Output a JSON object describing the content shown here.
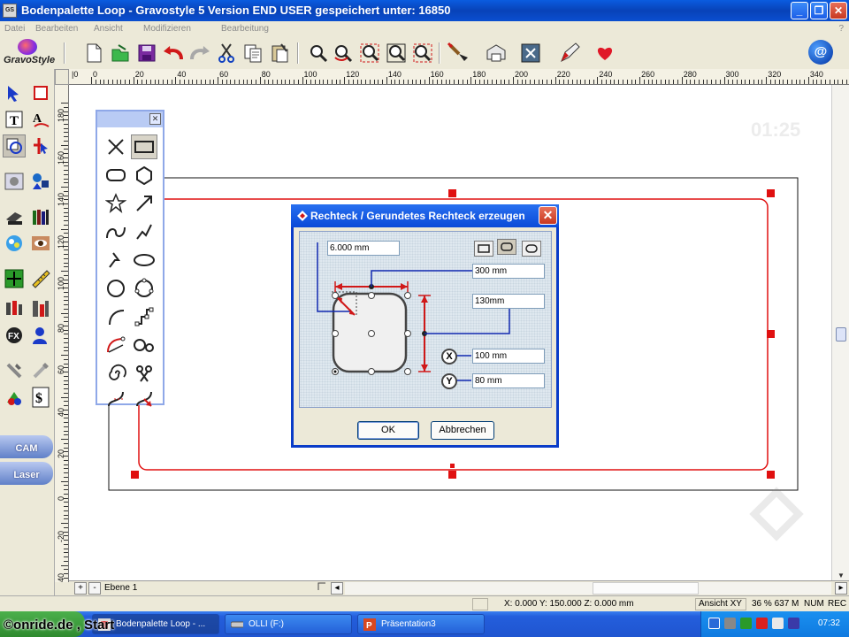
{
  "window": {
    "title": "Bodenpalette Loop - Gravostyle 5  Version END USER gespeichert unter: 16850",
    "app_icon": "GS",
    "minimize": "_",
    "maximize": "❐",
    "close": "✕"
  },
  "menu": {
    "items": [
      "Datei",
      "Bearbeiten",
      "Ansicht",
      "Modifizieren",
      "Bearbeitung"
    ],
    "help": "?"
  },
  "logo": {
    "text": "GravoStyle"
  },
  "toolbar": {
    "icons": [
      "new-file-icon",
      "open-icon",
      "save-icon",
      "undo-icon",
      "redo-icon",
      "cut-icon",
      "copy-icon",
      "paste-icon",
      "zoom-icon",
      "zoom-in-icon",
      "zoom-out-icon",
      "zoom-fit-icon",
      "zoom-selection-icon",
      "brush-icon",
      "printer-icon",
      "engraver-icon",
      "pen-icon",
      "heart-icon",
      "globe-icon"
    ],
    "globe_label": "@"
  },
  "rulers": {
    "horizontal": [
      "|0",
      "0",
      "20",
      "40",
      "60",
      "80",
      "100",
      "120",
      "140",
      "160",
      "180",
      "200",
      "220",
      "240",
      "260",
      "280",
      "300",
      "320",
      "340"
    ],
    "vertical": [
      "180",
      "160",
      "140",
      "120",
      "100",
      "80",
      "60",
      "40",
      "20",
      "0",
      "-20",
      "-40"
    ]
  },
  "canvas": {
    "time_display": "01:25"
  },
  "palette": {
    "close": "✕"
  },
  "dialog": {
    "title": "Rechteck / Gerundetes Rechteck erzeugen",
    "close": "✕",
    "radius": "6.000 mm",
    "width": "300 mm",
    "height": "130mm",
    "x_label": "X",
    "x_value": "100 mm",
    "y_label": "Y",
    "y_value": "80 mm",
    "ok": "OK",
    "cancel": "Abbrechen"
  },
  "layerbar": {
    "add": "+",
    "remove": "-",
    "layer": "Ebene 1"
  },
  "status": {
    "coords": "X: 0.000  Y: 150.000  Z: 0.000 mm",
    "view": "Ansicht XY",
    "zoom": "36 % 637 M",
    "num": "NUM",
    "rec": "REC"
  },
  "taskbar": {
    "watermark": "©onride.de , Start",
    "tasks": [
      "Bodenpalette Loop - ...",
      "OLLI (F:)",
      "Präsentation3"
    ],
    "clock": "07:32"
  },
  "colors": {
    "accent": "#0a4ad8",
    "shape_outline": "#e01010",
    "handle": "#e01010"
  }
}
